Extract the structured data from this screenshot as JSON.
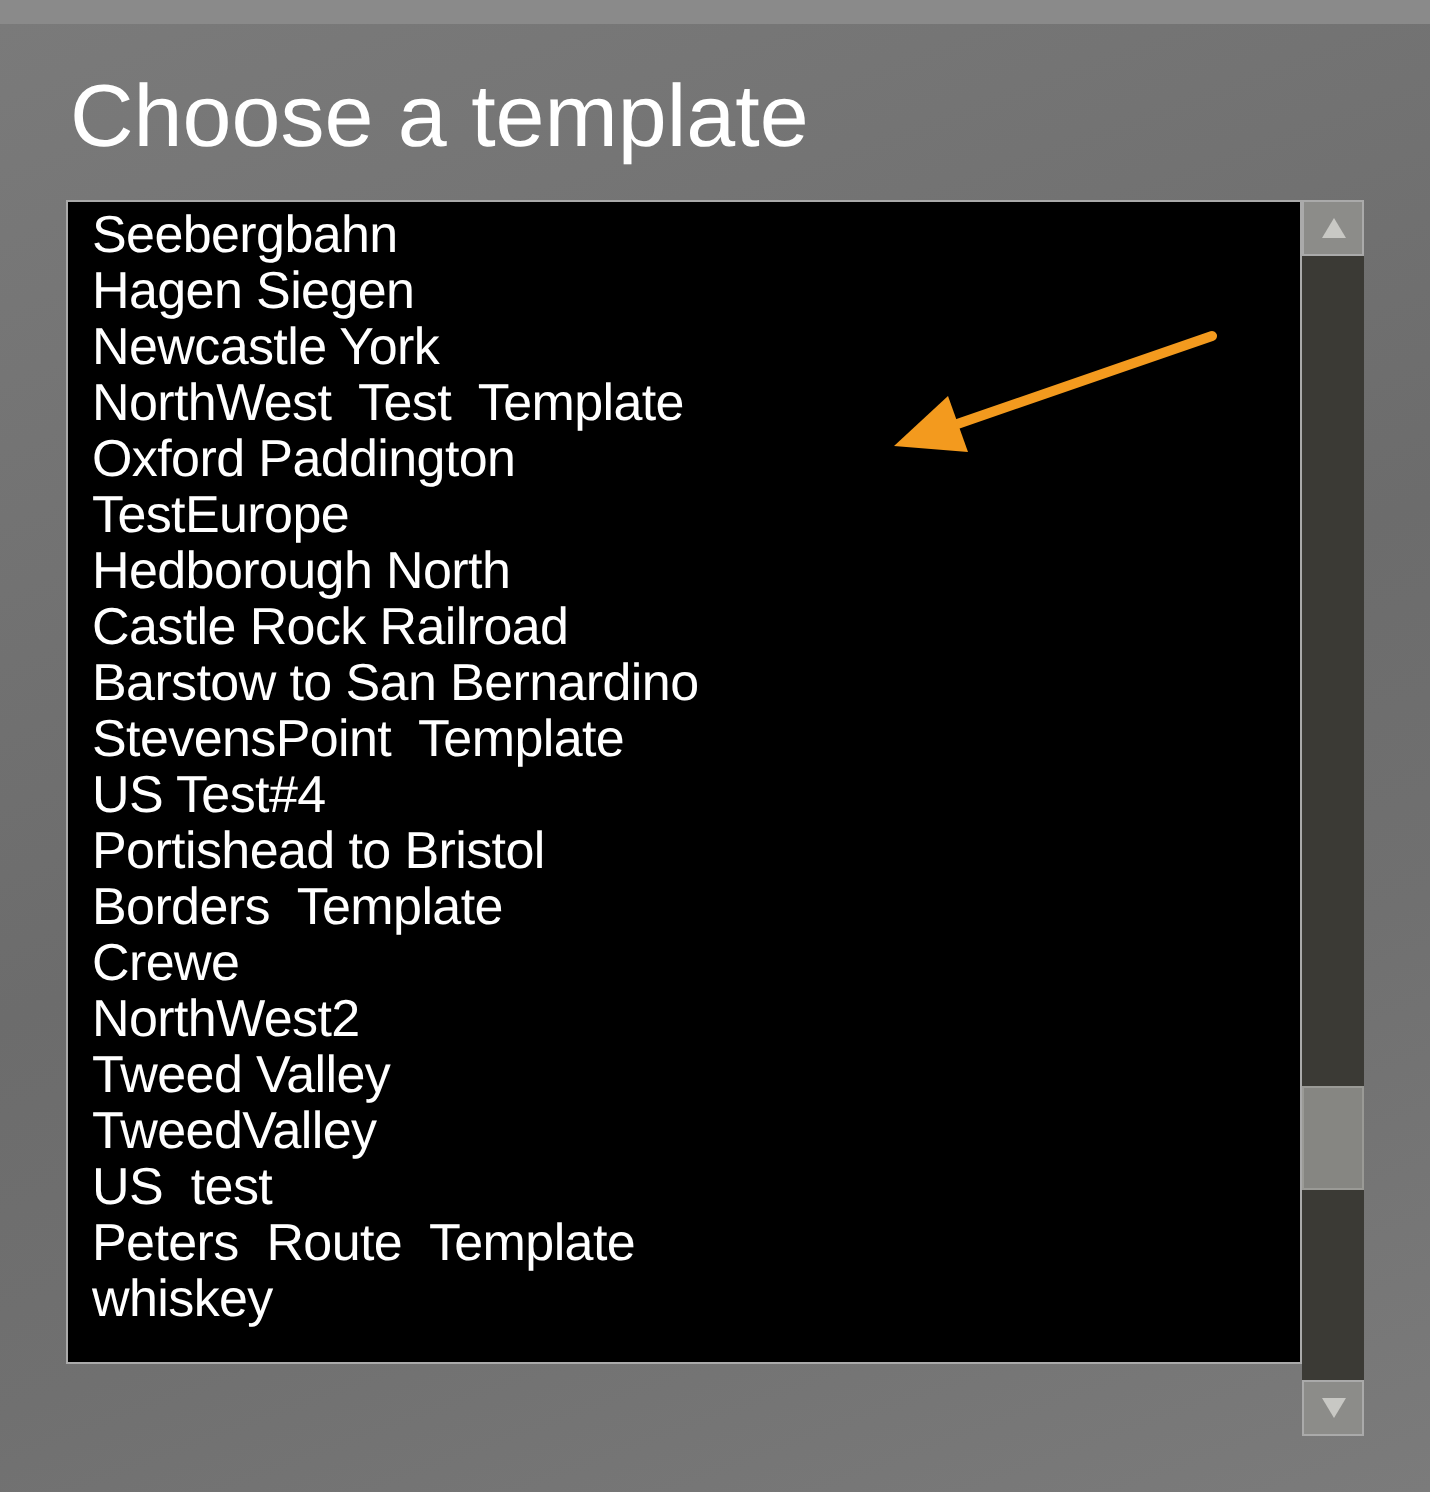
{
  "dialog": {
    "title": "Choose a template"
  },
  "templates": [
    {
      "label": "Seebergbahn"
    },
    {
      "label": "Hagen Siegen"
    },
    {
      "label": "Newcastle York"
    },
    {
      "label": "NorthWest  Test  Template"
    },
    {
      "label": "Oxford Paddington"
    },
    {
      "label": "TestEurope"
    },
    {
      "label": "Hedborough North"
    },
    {
      "label": "Castle Rock Railroad"
    },
    {
      "label": "Barstow to San Bernardino"
    },
    {
      "label": "StevensPoint  Template"
    },
    {
      "label": "US Test#4"
    },
    {
      "label": "Portishead to Bristol"
    },
    {
      "label": "Borders  Template"
    },
    {
      "label": "Crewe"
    },
    {
      "label": "NorthWest2"
    },
    {
      "label": "Tweed Valley"
    },
    {
      "label": "TweedValley"
    },
    {
      "label": "US  test"
    },
    {
      "label": "Peters  Route  Template"
    },
    {
      "label": "whiskey"
    }
  ]
}
